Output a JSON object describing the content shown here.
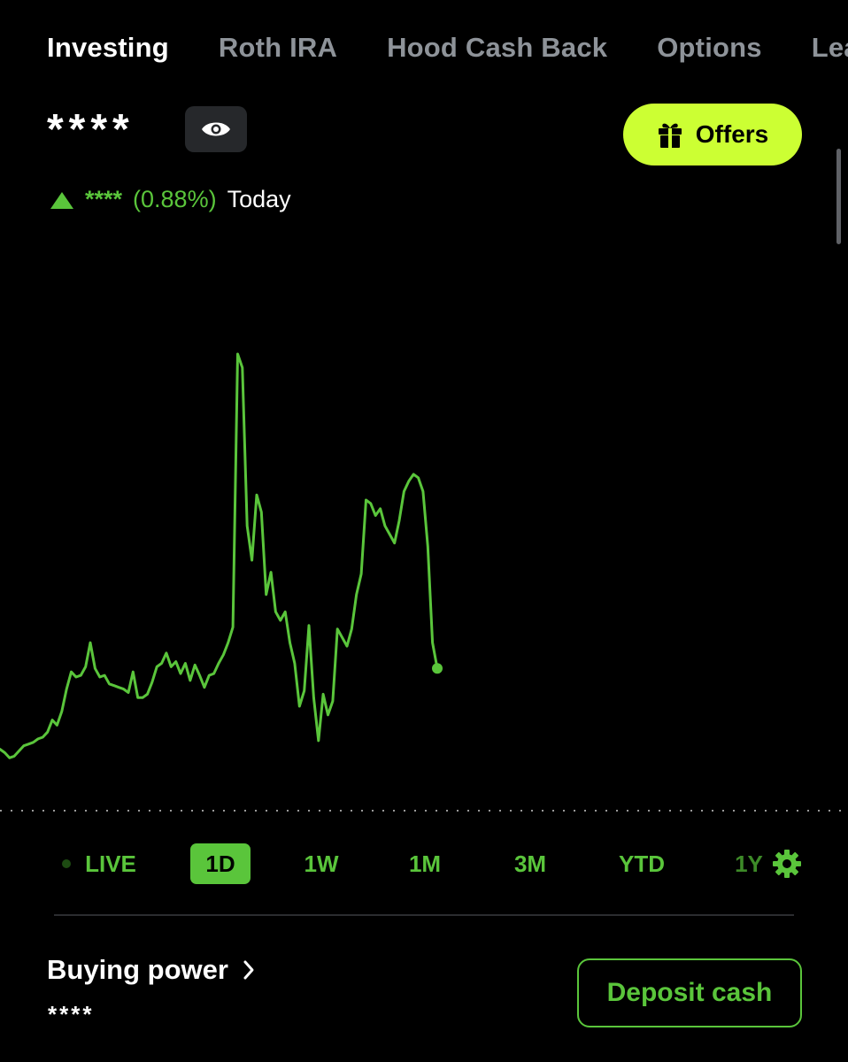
{
  "tabs": [
    {
      "label": "Investing",
      "active": true
    },
    {
      "label": "Roth IRA",
      "active": false
    },
    {
      "label": "Hood Cash Back",
      "active": false
    },
    {
      "label": "Options",
      "active": false
    },
    {
      "label": "Leap",
      "active": false
    }
  ],
  "portfolio": {
    "value_masked": "****",
    "visibility_icon": "eye-icon",
    "change_value_masked": "****",
    "change_percent": "(0.88%)",
    "change_period": "Today",
    "change_direction": "up"
  },
  "offers": {
    "label": "Offers",
    "icon": "gift-icon"
  },
  "ranges": [
    {
      "label": "LIVE",
      "selected": false
    },
    {
      "label": "1D",
      "selected": true
    },
    {
      "label": "1W",
      "selected": false
    },
    {
      "label": "1M",
      "selected": false
    },
    {
      "label": "3M",
      "selected": false
    },
    {
      "label": "YTD",
      "selected": false
    },
    {
      "label": "1Y",
      "selected": false
    }
  ],
  "settings_icon": "gear-icon",
  "buying_power": {
    "label": "Buying power",
    "value_masked": "****",
    "icon": "chevron-right-icon"
  },
  "deposit": {
    "label": "Deposit cash"
  },
  "colors": {
    "accent_green": "#5ac53b",
    "offers_bg": "#ccff33",
    "background": "#000000",
    "inactive_tab": "#8e9399"
  },
  "chart_data": {
    "type": "line",
    "title": "",
    "xlabel": "",
    "ylabel": "",
    "series": [
      {
        "values": [
          10,
          8,
          5,
          6,
          9,
          12,
          13,
          14,
          16,
          17,
          20,
          27,
          24,
          32,
          45,
          55,
          52,
          53,
          58,
          72,
          57,
          52,
          53,
          48,
          47,
          46,
          45,
          43,
          55,
          40,
          40,
          42,
          49,
          58,
          60,
          66,
          58,
          61,
          54,
          60,
          50,
          59,
          53,
          46,
          53,
          54,
          60,
          65,
          72,
          81,
          240,
          232,
          140,
          120,
          158,
          148,
          100,
          113,
          90,
          85,
          90,
          72,
          60,
          35,
          44,
          82,
          40,
          15,
          42,
          30,
          38,
          80,
          75,
          70,
          80,
          100,
          112,
          155,
          153,
          146,
          150,
          140,
          135,
          130,
          143,
          160,
          166,
          170,
          168,
          160,
          128,
          72,
          57
        ],
        "last_point_marker": true
      }
    ],
    "baseline": "dotted",
    "grid": false,
    "legend": "none"
  }
}
